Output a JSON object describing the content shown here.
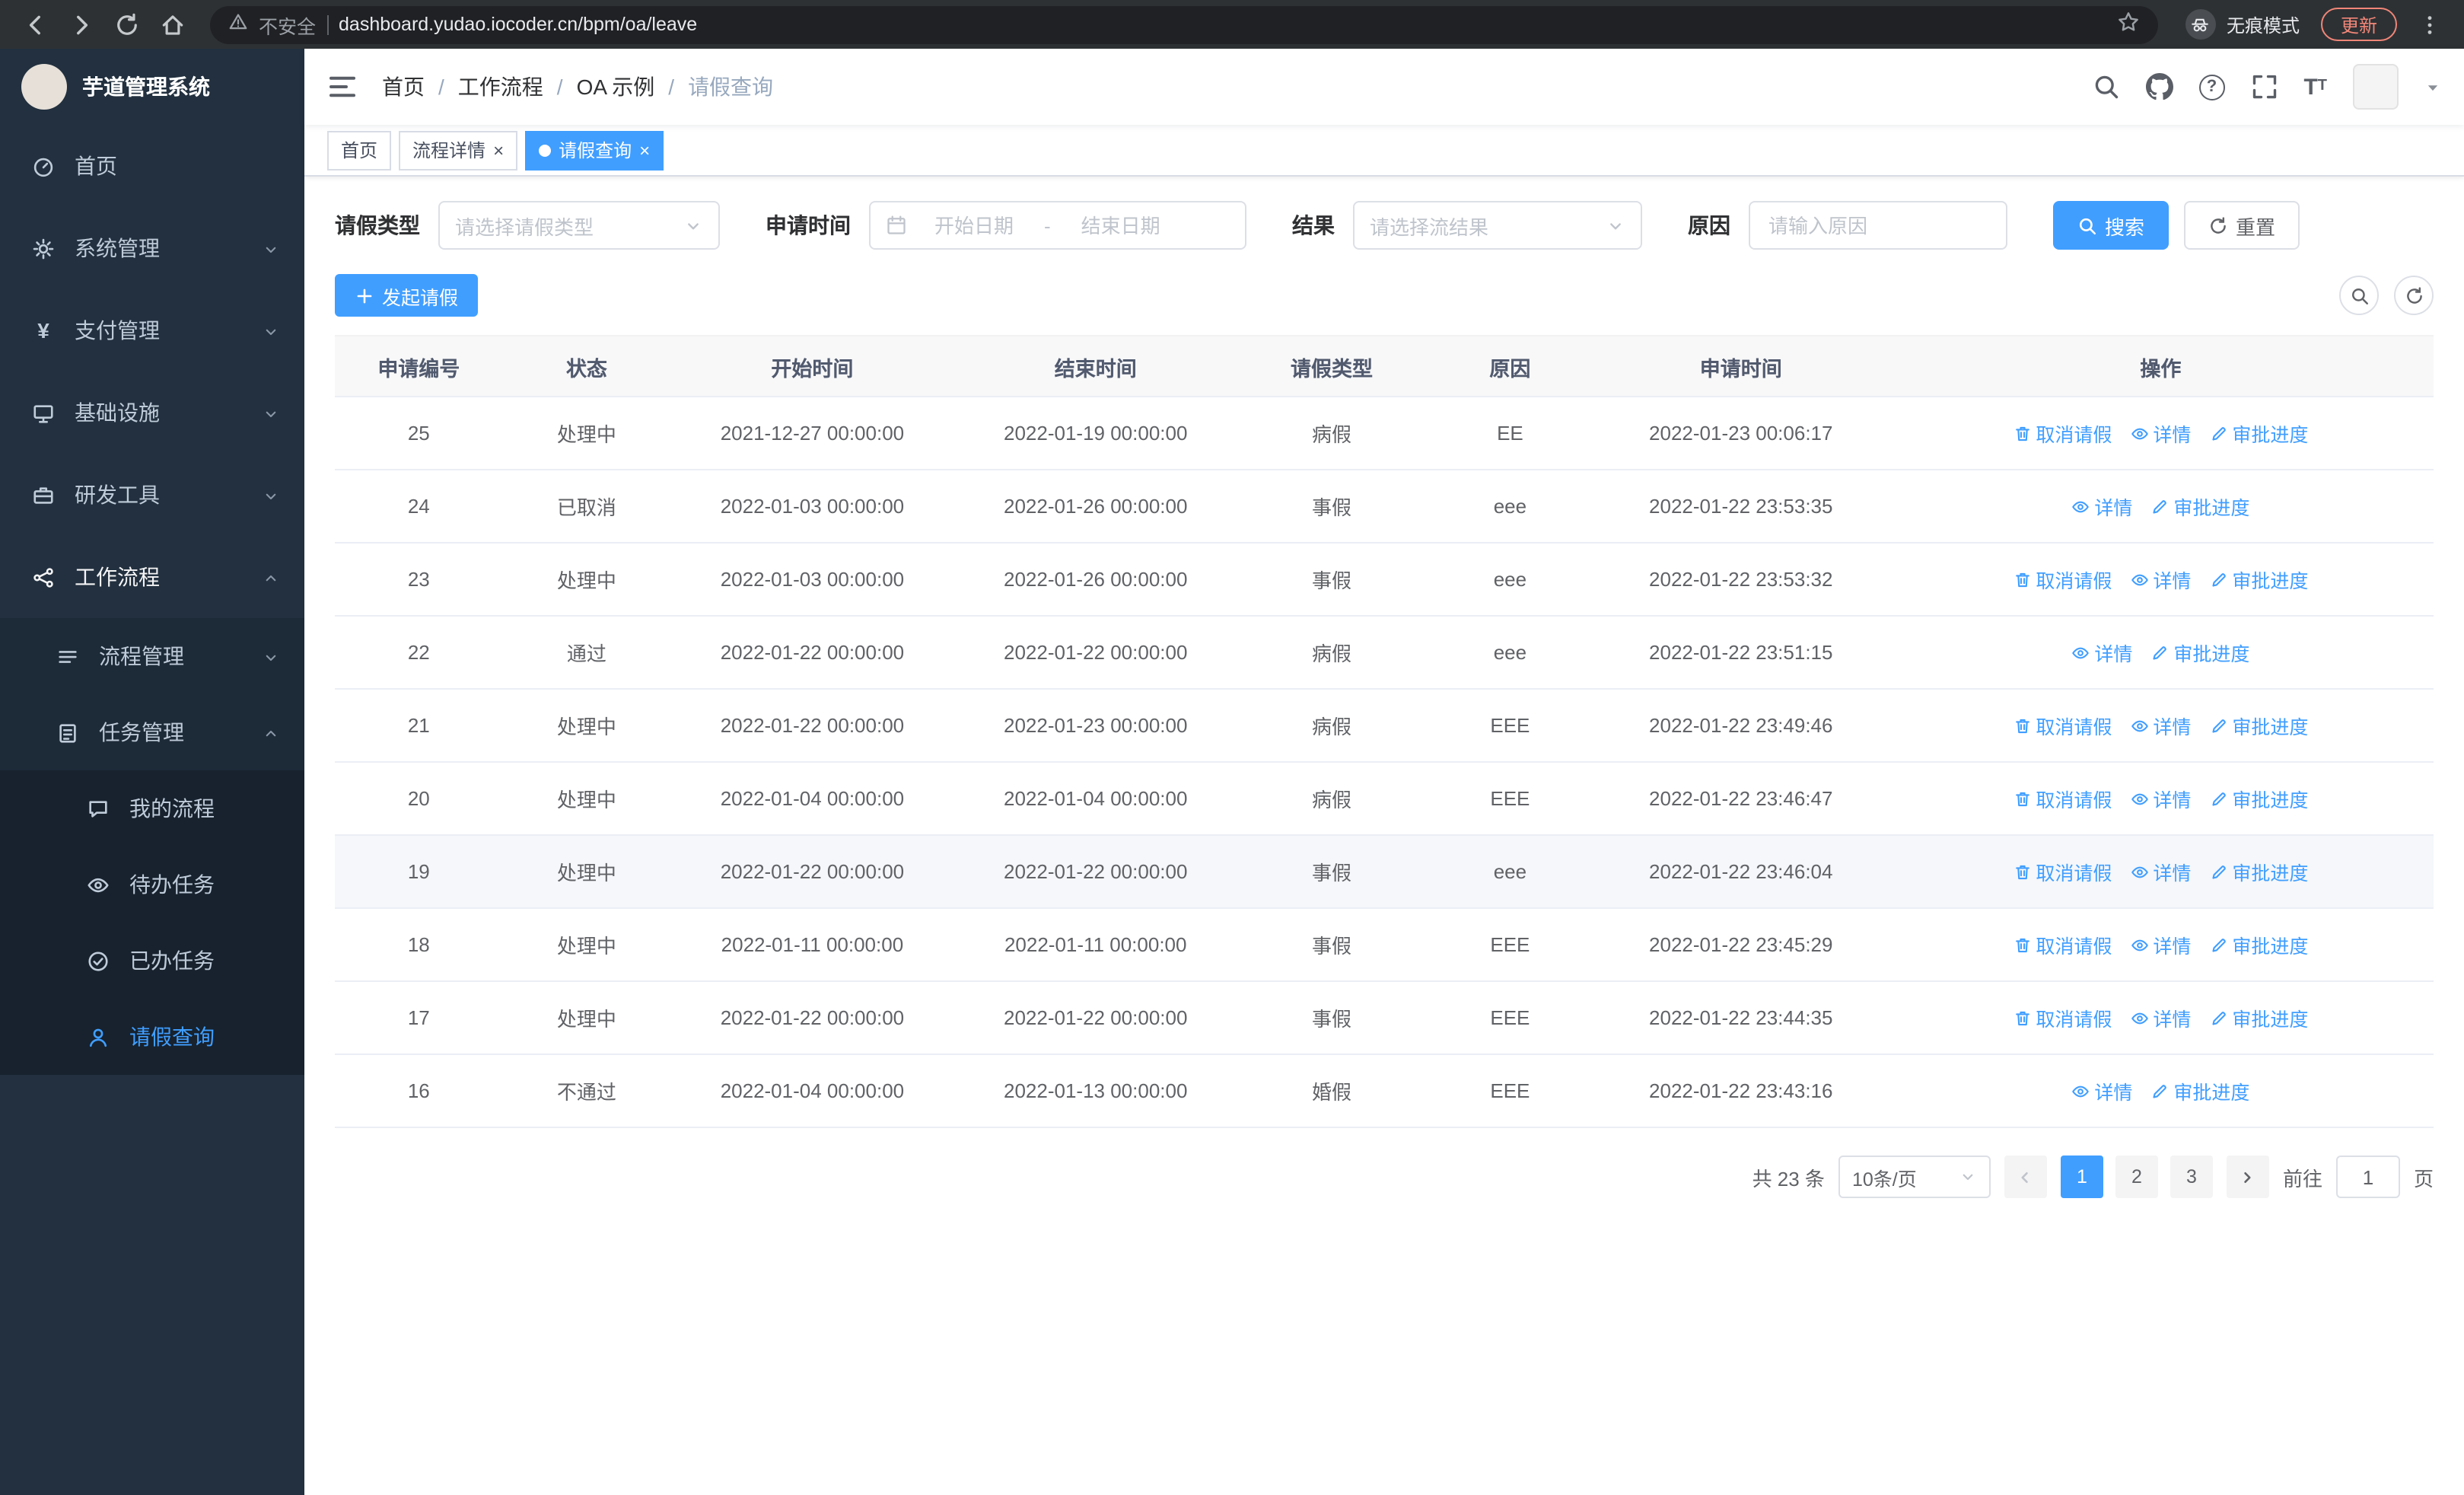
{
  "colors": {
    "accent": "#409eff",
    "sidebar_bg": "#22303f",
    "sidebar_sub_bg": "#1d2a38",
    "sidebar_sub2_bg": "#17222e",
    "chrome_bg": "#2e3134",
    "omnibox_bg": "#202124",
    "update_accent": "#f08678"
  },
  "browser": {
    "security_warning": "不安全",
    "url": "dashboard.yudao.iocoder.cn/bpm/oa/leave",
    "incognito_label": "无痕模式",
    "update_label": "更新"
  },
  "app": {
    "title": "芋道管理系统"
  },
  "sidebar": {
    "items": [
      {
        "key": "home",
        "label": "首页",
        "icon": "dashboard",
        "level": 1
      },
      {
        "key": "system",
        "label": "系统管理",
        "icon": "gear",
        "level": 1,
        "chevron": "down"
      },
      {
        "key": "payment",
        "label": "支付管理",
        "icon": "yen",
        "level": 1,
        "chevron": "down"
      },
      {
        "key": "infrastructure",
        "label": "基础设施",
        "icon": "infra",
        "level": 1,
        "chevron": "down"
      },
      {
        "key": "devtools",
        "label": "研发工具",
        "icon": "tools",
        "level": 1,
        "chevron": "down"
      },
      {
        "key": "workflow",
        "label": "工作流程",
        "icon": "workflow",
        "level": 1,
        "chevron": "up",
        "expanded": true
      },
      {
        "key": "process-mgmt",
        "label": "流程管理",
        "icon": "list",
        "level": 2,
        "chevron": "down"
      },
      {
        "key": "task-mgmt",
        "label": "任务管理",
        "icon": "tasks",
        "level": 2,
        "chevron": "up"
      },
      {
        "key": "my-process",
        "label": "我的流程",
        "icon": "chat",
        "level": 3
      },
      {
        "key": "todo-task",
        "label": "待办任务",
        "icon": "eye",
        "level": 3
      },
      {
        "key": "done-task",
        "label": "已办任务",
        "icon": "done",
        "level": 3
      },
      {
        "key": "leave-query",
        "label": "请假查询",
        "icon": "user",
        "level": 3,
        "active": true
      }
    ]
  },
  "breadcrumb": {
    "items": [
      "首页",
      "工作流程",
      "OA 示例",
      "请假查询"
    ]
  },
  "tabs": {
    "items": [
      {
        "label": "首页"
      },
      {
        "label": "流程详情",
        "closable": true
      },
      {
        "label": "请假查询",
        "closable": true,
        "active": true
      }
    ]
  },
  "filters": {
    "leave_type_label": "请假类型",
    "leave_type_placeholder": "请选择请假类型",
    "apply_time_label": "申请时间",
    "start_date_placeholder": "开始日期",
    "end_date_placeholder": "结束日期",
    "range_separator": "-",
    "result_label": "结果",
    "result_placeholder": "请选择流结果",
    "reason_label": "原因",
    "reason_placeholder": "请输入原因",
    "search_button": "搜索",
    "reset_button": "重置"
  },
  "toolbar": {
    "create_label": "发起请假"
  },
  "table": {
    "columns": [
      "申请编号",
      "状态",
      "开始时间",
      "结束时间",
      "请假类型",
      "原因",
      "申请时间",
      "操作"
    ],
    "op_defs": {
      "cancel": {
        "label": "取消请假",
        "icon": "trash"
      },
      "detail": {
        "label": "详情",
        "icon": "eye"
      },
      "progress": {
        "label": "审批进度",
        "icon": "edit"
      }
    },
    "rows": [
      {
        "id": "25",
        "status": "处理中",
        "start": "2021-12-27 00:00:00",
        "end": "2022-01-19 00:00:00",
        "type": "病假",
        "reason": "EE",
        "applied": "2022-01-23 00:06:17",
        "ops": [
          "cancel",
          "detail",
          "progress"
        ]
      },
      {
        "id": "24",
        "status": "已取消",
        "start": "2022-01-03 00:00:00",
        "end": "2022-01-26 00:00:00",
        "type": "事假",
        "reason": "eee",
        "applied": "2022-01-22 23:53:35",
        "ops": [
          "detail",
          "progress"
        ]
      },
      {
        "id": "23",
        "status": "处理中",
        "start": "2022-01-03 00:00:00",
        "end": "2022-01-26 00:00:00",
        "type": "事假",
        "reason": "eee",
        "applied": "2022-01-22 23:53:32",
        "ops": [
          "cancel",
          "detail",
          "progress"
        ]
      },
      {
        "id": "22",
        "status": "通过",
        "start": "2022-01-22 00:00:00",
        "end": "2022-01-22 00:00:00",
        "type": "病假",
        "reason": "eee",
        "applied": "2022-01-22 23:51:15",
        "ops": [
          "detail",
          "progress"
        ]
      },
      {
        "id": "21",
        "status": "处理中",
        "start": "2022-01-22 00:00:00",
        "end": "2022-01-23 00:00:00",
        "type": "病假",
        "reason": "EEE",
        "applied": "2022-01-22 23:49:46",
        "ops": [
          "cancel",
          "detail",
          "progress"
        ]
      },
      {
        "id": "20",
        "status": "处理中",
        "start": "2022-01-04 00:00:00",
        "end": "2022-01-04 00:00:00",
        "type": "病假",
        "reason": "EEE",
        "applied": "2022-01-22 23:46:47",
        "ops": [
          "cancel",
          "detail",
          "progress"
        ]
      },
      {
        "id": "19",
        "status": "处理中",
        "start": "2022-01-22 00:00:00",
        "end": "2022-01-22 00:00:00",
        "type": "事假",
        "reason": "eee",
        "applied": "2022-01-22 23:46:04",
        "ops": [
          "cancel",
          "detail",
          "progress"
        ],
        "highlighted": true
      },
      {
        "id": "18",
        "status": "处理中",
        "start": "2022-01-11 00:00:00",
        "end": "2022-01-11 00:00:00",
        "type": "事假",
        "reason": "EEE",
        "applied": "2022-01-22 23:45:29",
        "ops": [
          "cancel",
          "detail",
          "progress"
        ]
      },
      {
        "id": "17",
        "status": "处理中",
        "start": "2022-01-22 00:00:00",
        "end": "2022-01-22 00:00:00",
        "type": "事假",
        "reason": "EEE",
        "applied": "2022-01-22 23:44:35",
        "ops": [
          "cancel",
          "detail",
          "progress"
        ]
      },
      {
        "id": "16",
        "status": "不通过",
        "start": "2022-01-04 00:00:00",
        "end": "2022-01-13 00:00:00",
        "type": "婚假",
        "reason": "EEE",
        "applied": "2022-01-22 23:43:16",
        "ops": [
          "detail",
          "progress"
        ]
      }
    ]
  },
  "pagination": {
    "total_label": "共 23 条",
    "page_size_label": "10条/页",
    "pages": [
      "1",
      "2",
      "3"
    ],
    "active_page": "1",
    "goto_prefix": "前往",
    "goto_value": "1",
    "goto_suffix": "页"
  }
}
